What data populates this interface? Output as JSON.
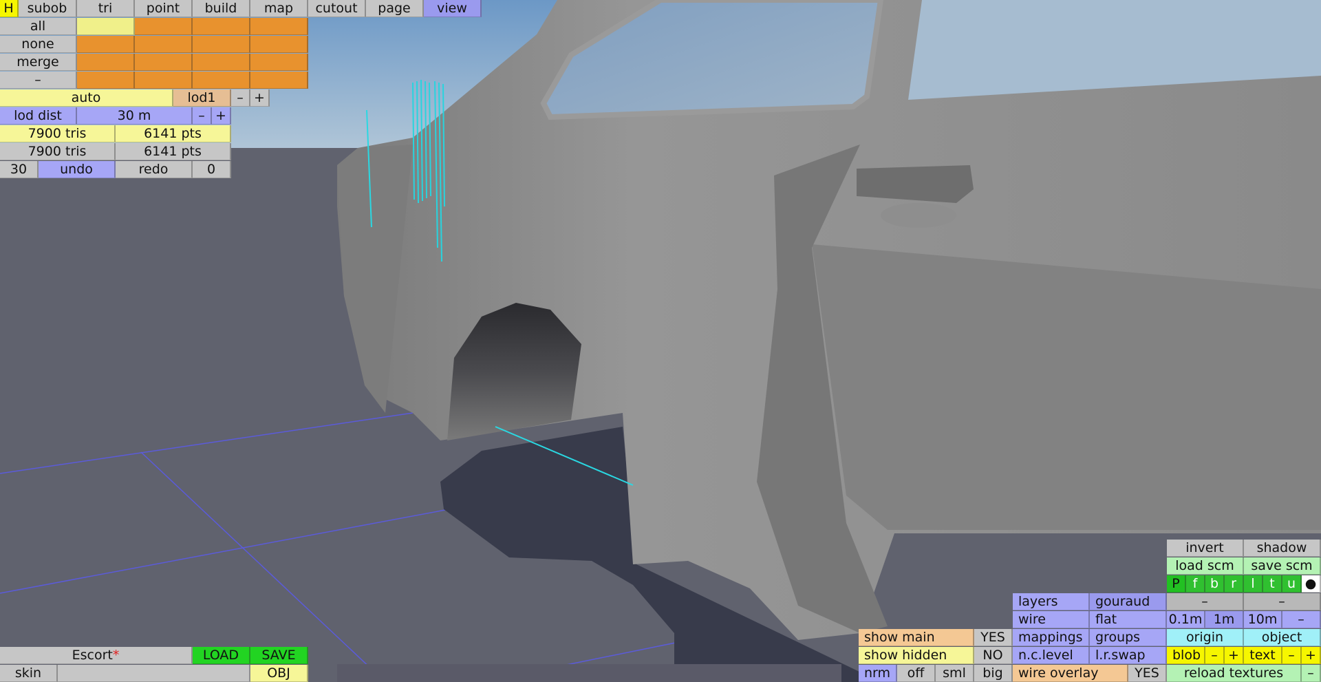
{
  "menu": {
    "h": "H",
    "tabs": [
      "subob",
      "tri",
      "point",
      "build",
      "map",
      "cutout",
      "page",
      "view"
    ]
  },
  "select": {
    "rows": [
      "all",
      "none",
      "merge",
      "–"
    ]
  },
  "lod": {
    "auto": "auto",
    "level": "lod1",
    "minus": "–",
    "plus": "+",
    "dist_label": "lod dist",
    "dist_value": "30 m"
  },
  "stats": {
    "tris1": "7900 tris",
    "pts1": "6141 pts",
    "tris2": "7900 tris",
    "pts2": "6141 pts"
  },
  "history": {
    "count": "30",
    "undo": "undo",
    "redo": "redo",
    "redo_count": "0"
  },
  "file": {
    "name": "Escort",
    "modified_mark": "*",
    "load": "LOAD",
    "save": "SAVE",
    "skin": "skin",
    "format": "OBJ"
  },
  "show": {
    "main": "show main",
    "main_val": "YES",
    "hidden": "show hidden",
    "hidden_val": "NO"
  },
  "size": {
    "nrm": "nrm",
    "off": "off",
    "sml": "sml",
    "big": "big"
  },
  "render": {
    "layers": "layers",
    "gouraud": "gouraud",
    "wire": "wire",
    "flat": "flat",
    "mappings": "mappings",
    "groups": "groups",
    "nclevel": "n.c.level",
    "lrswap": "l.r.swap",
    "wire_overlay": "wire overlay",
    "wire_overlay_val": "YES"
  },
  "right": {
    "invert": "invert",
    "shadow": "shadow",
    "load_scm": "load scm",
    "save_scm": "save scm",
    "views": [
      "P",
      "f",
      "b",
      "r",
      "l",
      "t",
      "u"
    ],
    "dot": "●",
    "dash1": "–",
    "dash2": "–",
    "grid": [
      "0.1m",
      "1m",
      "10m",
      "–"
    ],
    "origin": "origin",
    "object": "object",
    "blob": "blob",
    "blob_minus": "–",
    "blob_plus": "+",
    "text": "text",
    "text_minus": "–",
    "text_plus": "+",
    "reload": "reload textures",
    "reload_minus": "–"
  },
  "colors": {
    "sky": "#8fb0cf",
    "ground": "#60626e",
    "body": "#8c8c8c",
    "shadow": "#383b4b",
    "grid_line": "#5b5bdb",
    "wire_highlight": "#2ad8e2"
  }
}
